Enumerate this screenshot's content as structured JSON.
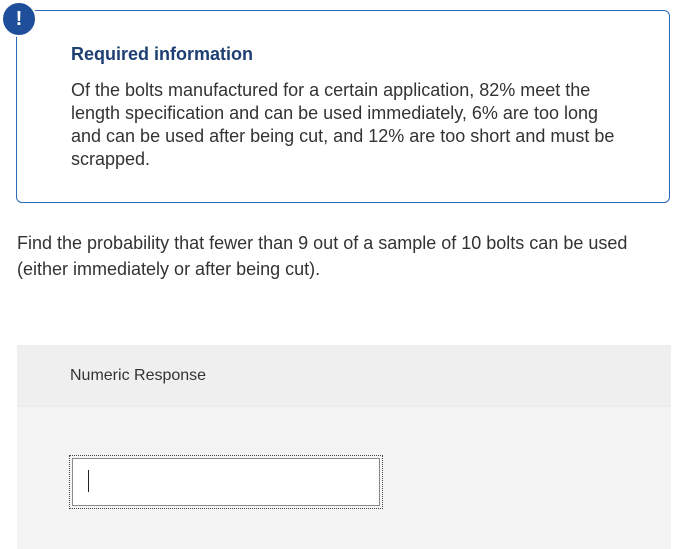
{
  "alert": {
    "icon": "exclamation-icon",
    "glyph": "!",
    "color": "#1f4f9a"
  },
  "info": {
    "title": "Required information",
    "body": "Of the bolts manufactured for a certain application, 82% meet the length specification and can be used immediately, 6% are too long and can be used after being cut, and 12% are too short and must be scrapped."
  },
  "question": {
    "text": "Find the probability that fewer than 9 out of a sample of 10 bolts can be used (either immediately or after being cut)."
  },
  "response": {
    "label": "Numeric Response",
    "value": ""
  },
  "colors": {
    "title": "#1e3f73",
    "border": "#2a6bb5",
    "response_bg": "#f4f4f4"
  }
}
